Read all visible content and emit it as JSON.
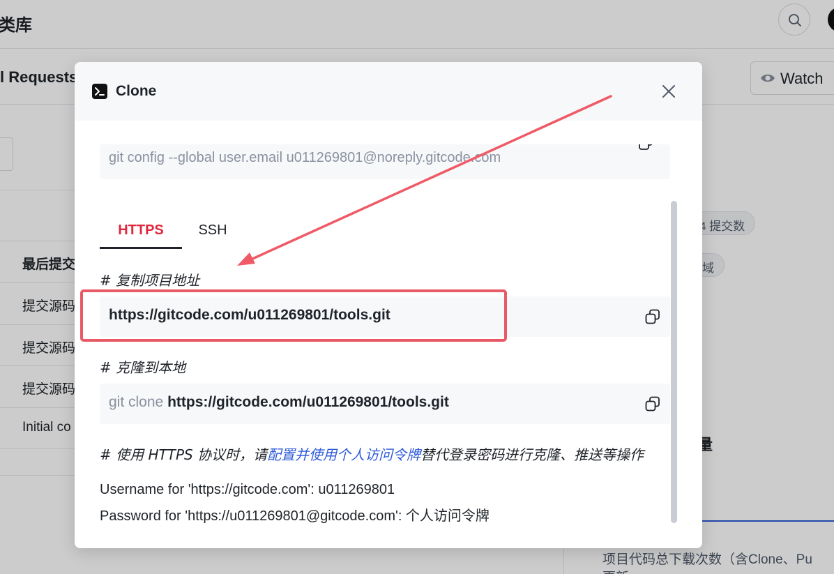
{
  "background": {
    "title": "类库",
    "tab_pull_requests": "l Requests",
    "watch_label": "Watch",
    "column_header": "最后提交",
    "rows": [
      "提交源码",
      "提交源码",
      "提交源码",
      "Initial co"
    ],
    "badge_commits": "4 提交数",
    "badge_domain": "域",
    "right_section_title": "量",
    "footnote_line1": "项目代码总下载次数（含Clone、Pu",
    "footnote_line2": "更新"
  },
  "modal": {
    "title": "Clone",
    "config_command": "git config --global user.email u011269801@noreply.gitcode.com",
    "tabs": [
      {
        "label": "HTTPS",
        "active": true
      },
      {
        "label": "SSH",
        "active": false
      }
    ],
    "copy_comment": "# 复制项目地址",
    "repo_url": "https://gitcode.com/u011269801/tools.git",
    "clone_comment": "# 克隆到本地",
    "clone_prefix": "git clone ",
    "clone_url": "https://gitcode.com/u011269801/tools.git",
    "https_note_before": "# 使用 HTTPS 协议时，请",
    "https_note_link": "配置并使用个人访问令牌",
    "https_note_after": "替代登录密码进行克隆、推送等操作",
    "username_line": "Username for 'https://gitcode.com': u011269801",
    "password_line": "Password for 'https://u011269801@gitcode.com': 个人访问令牌"
  },
  "colors": {
    "accent_red": "#e0263c",
    "link_blue": "#2e5bd8",
    "annotation_red": "#e85a66"
  }
}
